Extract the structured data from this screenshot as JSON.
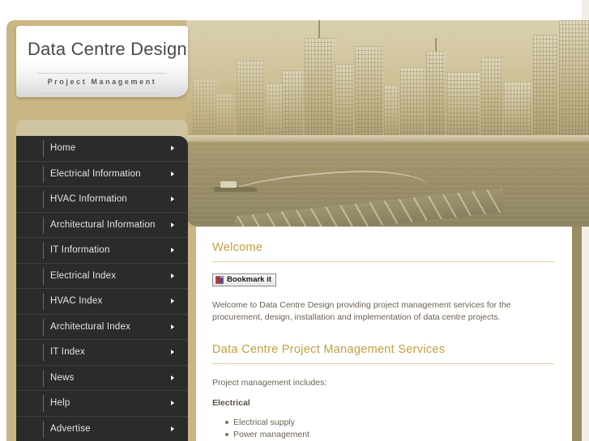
{
  "site": {
    "logo_title": "Data Centre Design",
    "logo_subtitle": "Project Management"
  },
  "nav": {
    "items": [
      {
        "label": "Home",
        "arrow": "chevron-right-icon"
      },
      {
        "label": "Electrical Information",
        "arrow": "chevron-right-icon"
      },
      {
        "label": "HVAC Information",
        "arrow": "chevron-right-icon"
      },
      {
        "label": "Architectural Information",
        "arrow": "chevron-right-icon"
      },
      {
        "label": "IT Information",
        "arrow": "chevron-right-icon"
      },
      {
        "label": "Electrical Index",
        "arrow": "chevron-right-icon"
      },
      {
        "label": "HVAC Index",
        "arrow": "chevron-right-icon"
      },
      {
        "label": "Architectural Index",
        "arrow": "chevron-right-icon"
      },
      {
        "label": "IT Index",
        "arrow": "chevron-right-icon"
      },
      {
        "label": "News",
        "arrow": "chevron-right-icon"
      },
      {
        "label": "Help",
        "arrow": "chevron-right-icon"
      },
      {
        "label": "Advertise",
        "arrow": "chevron-right-icon"
      }
    ]
  },
  "content": {
    "welcome_heading": "Welcome",
    "bookmark_label": "Bookmark it",
    "welcome_text": "Welcome to Data Centre Design providing project management services for the procurement, design, installation and implementation of data centre projects.",
    "services_heading": "Data Centre Project Management Services",
    "includes_label": "Project management includes:",
    "electrical_label": "Electrical",
    "electrical_items": [
      "Electrical supply",
      "Power management"
    ]
  },
  "colors": {
    "accent_gold": "#c29f3f",
    "frame_tan": "#c9b684",
    "nav_dark": "#2b2b2b",
    "body_text": "#6b6153"
  }
}
